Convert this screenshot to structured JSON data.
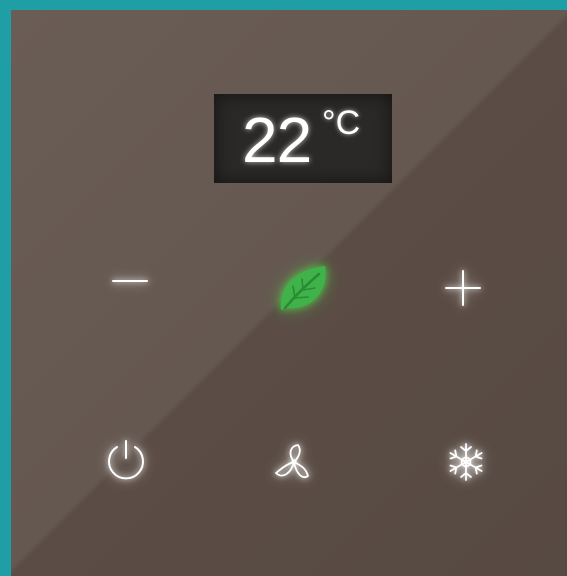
{
  "display": {
    "temperature": "22",
    "unit": "°C"
  },
  "controls": {
    "row1": [
      {
        "name": "decrease-temperature",
        "icon": "minus-icon"
      },
      {
        "name": "eco-mode",
        "icon": "leaf-icon",
        "active": true
      },
      {
        "name": "increase-temperature",
        "icon": "plus-icon"
      }
    ],
    "row2": [
      {
        "name": "power",
        "icon": "power-icon"
      },
      {
        "name": "fan-mode",
        "icon": "fan-icon"
      },
      {
        "name": "cool-mode",
        "icon": "snowflake-icon"
      }
    ]
  },
  "colors": {
    "frame": "#1f9ea5",
    "panel": "#655850",
    "display": "#2b2927",
    "icon": "#ffffff",
    "eco_active": "#3fb34a"
  }
}
